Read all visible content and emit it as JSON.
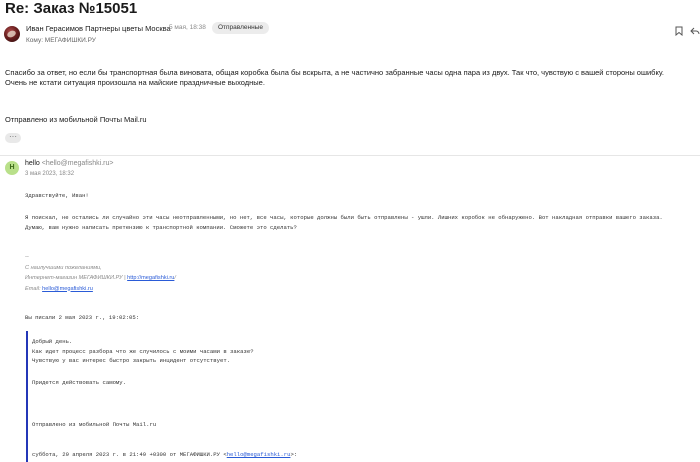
{
  "subject": "Re: Заказ №15051",
  "header": {
    "sender_name": "Иван Герасимов Партнеры цветы Москва",
    "date": "5 мая, 18:38",
    "status_badge": "Отправленные",
    "to_label": "Кому: МЕГАФИШКИ.РУ",
    "icons": [
      "bookmark-icon",
      "reply-icon"
    ]
  },
  "message": {
    "line1": "Спасибо за ответ, но если бы транспортная была виновата, общая коробка была бы вскрыта, а не частично забранные часы одна пара из двух. Так что, чувствую с вашей стороны ошибку.",
    "line2": "Очень не кстати ситуация произошла на майские праздничные выходные.",
    "sent_from": "Отправлено из мобильной Почты Mail.ru",
    "more_label": "···"
  },
  "quoted": {
    "avatar_letter": "H",
    "sender_name": "hello",
    "sender_addr": "<hello@megafishki.ru>",
    "date": "3 мая 2023, 18:32",
    "greeting": "Здравствуйте, Иван!",
    "para1": "Я поискал, не остались ли случайно эти часы неотправленными, но нет, все часы, которые должны были быть отправлены - ушли. Лишних коробок не обнаружено. Вот накладная отправки вашего заказа.",
    "para2": "Думаю, вам нужно написать претензию к транспортной компании. Сможете это сделать?",
    "sig_dash": "--",
    "sig_regards": "С наилучшими пожеланиями,",
    "sig_shop_prefix": "Интернет-магазин МЕГАФИШКИ.РУ |",
    "sig_shop_link": "http://megafishki.ru",
    "sig_shop_suffix": "/",
    "sig_email_label": "Email:",
    "sig_email_link": "hello@megafishki.ru",
    "wrote": "Вы писали 2 мая 2023 г., 19:02:05:",
    "q_line1": "Добрый день.",
    "q_line2": "Как идет процесс разбора что же случилось с моими часами в заказе?",
    "q_line3": "Чувствую у вас интерес быстро закрыть инцидент отсутствует.",
    "q_line4": "Придется действовать самому.",
    "q_sent_from": "Отправлено из мобильной Почты Mail.ru",
    "q_nested_prefix": "суббота, 29 апреля 2023 г. в 21:49 +0300 от МЕГАФИШКИ.РУ <",
    "q_nested_link": "hello@megafishki.ru",
    "q_nested_suffix": ">:"
  }
}
